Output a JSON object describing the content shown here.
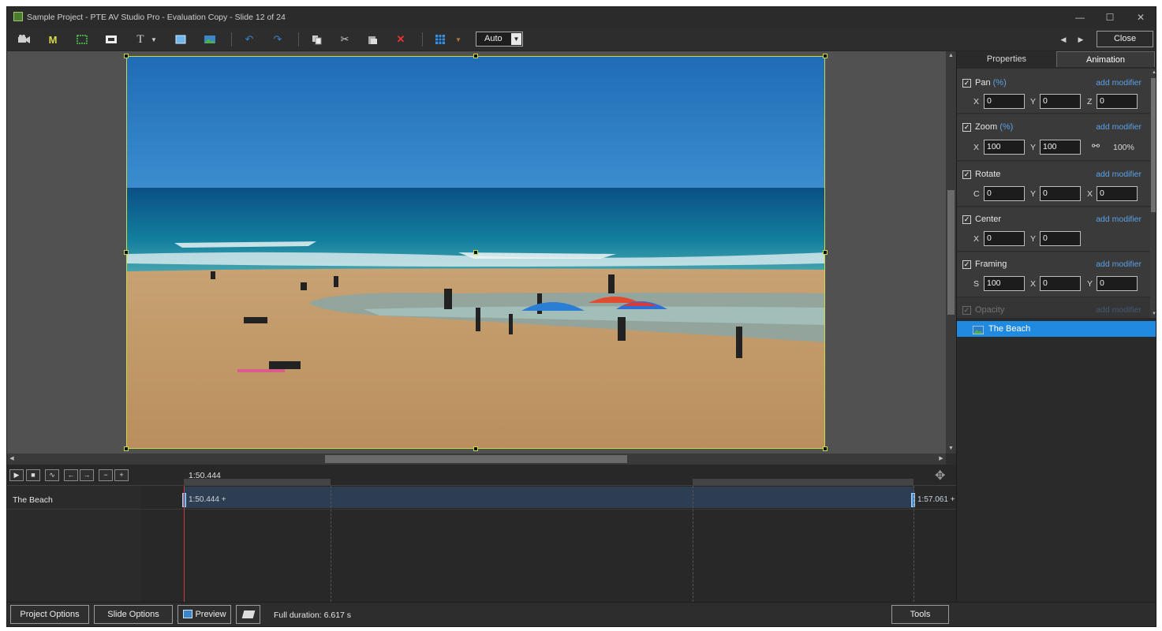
{
  "window": {
    "title": "Sample Project - PTE AV Studio Pro - Evaluation Copy - Slide 12 of 24",
    "controls": {
      "minimize": "—",
      "maximize": "☐",
      "close": "✕"
    }
  },
  "toolbar": {
    "icons": [
      "camera-icon",
      "mask-icon",
      "frame-icon",
      "image-icon",
      "text-icon",
      "rectangle-icon",
      "picture-icon",
      "undo-icon",
      "redo-icon",
      "copy-icon",
      "cut-icon",
      "paste-icon",
      "delete-icon",
      "grid-icon",
      "grid-dropdown-icon"
    ],
    "text_tool": "T",
    "mask_label": "M",
    "grid_mode": "Auto",
    "close_label": "Close"
  },
  "tabs": [
    {
      "label": "Properties",
      "active": false
    },
    {
      "label": "Animation",
      "active": true
    }
  ],
  "animation": {
    "add_modifier": "add modifier",
    "pan": {
      "label": "Pan",
      "unit": "(%)",
      "checked": true,
      "fields": [
        {
          "axis": "X",
          "value": "0"
        },
        {
          "axis": "Y",
          "value": "0"
        },
        {
          "axis": "Z",
          "value": "0"
        }
      ]
    },
    "zoom": {
      "label": "Zoom",
      "unit": "(%)",
      "checked": true,
      "fields": [
        {
          "axis": "X",
          "value": "100"
        },
        {
          "axis": "Y",
          "value": "100"
        }
      ],
      "linked_value": "100%"
    },
    "rotate": {
      "label": "Rotate",
      "checked": true,
      "fields": [
        {
          "axis": "C",
          "value": "0"
        },
        {
          "axis": "Y",
          "value": "0"
        },
        {
          "axis": "X",
          "value": "0"
        }
      ]
    },
    "center": {
      "label": "Center",
      "checked": true,
      "fields": [
        {
          "axis": "X",
          "value": "0"
        },
        {
          "axis": "Y",
          "value": "0"
        }
      ]
    },
    "framing": {
      "label": "Framing",
      "checked": true,
      "fields": [
        {
          "axis": "S",
          "value": "100"
        },
        {
          "axis": "X",
          "value": "0"
        },
        {
          "axis": "Y",
          "value": "0"
        }
      ]
    },
    "opacity": {
      "label": "Opacity",
      "checked": true
    }
  },
  "objects": {
    "selected": "The Beach"
  },
  "timeline": {
    "buttons": [
      "play-icon",
      "stop-icon",
      "waveform-icon",
      "prev-keyframe-icon",
      "next-keyframe-icon",
      "remove-keyframe-icon",
      "add-keyframe-icon"
    ],
    "cursor_time": "1:50.444",
    "track_name": "The Beach",
    "start_key": "1:50.444 +",
    "end_key": "1:57.061 +"
  },
  "bottom": {
    "project_options": "Project Options",
    "slide_options": "Slide Options",
    "preview": "Preview",
    "full_duration": "Full duration: 6.617 s",
    "tools": "Tools"
  },
  "colors": {
    "accent": "#1f8ae0",
    "link": "#5aa0e6",
    "selection_frame": "#c8d94a",
    "playhead": "#c83c3c"
  }
}
